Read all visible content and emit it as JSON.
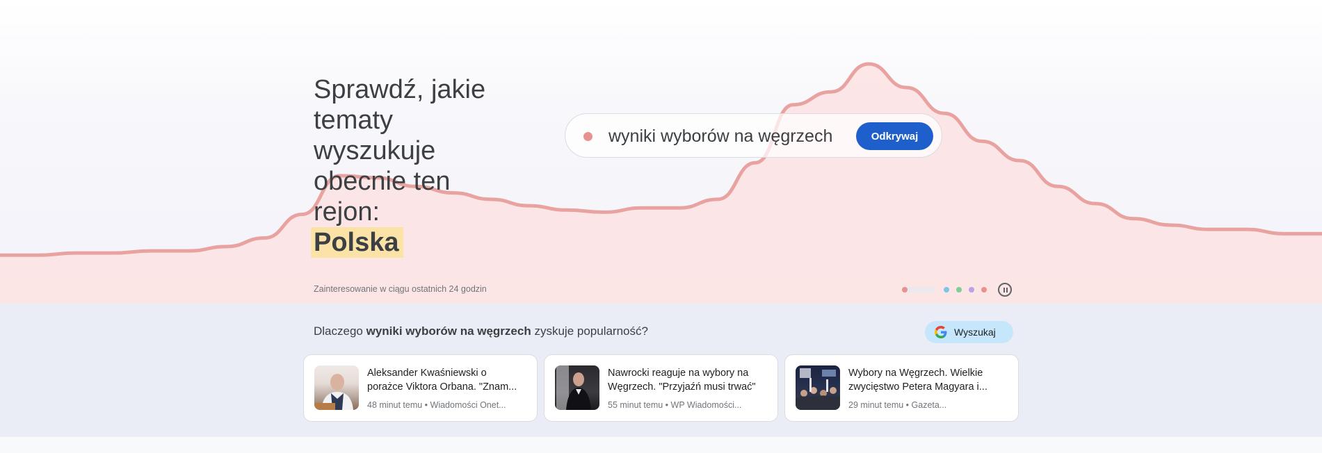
{
  "hero": {
    "headline": "Sprawdź, jakie tematy wyszukuje obecnie ten rejon:",
    "region": "Polska",
    "caption": "Zainteresowanie w ciągu ostatnich 24 godzin",
    "search_term": "wyniki wyborów na węgrzech",
    "discover_label": "Odkrywaj",
    "trend_color": "#e8a3a1",
    "trend_fill": "#fbe2e2",
    "carousel": {
      "active_index": 0,
      "dot_colors": [
        "#e8928f",
        "#7cc6ea",
        "#7ccf96",
        "#b9a2e6",
        "#e8928f"
      ]
    }
  },
  "chart_data": {
    "type": "area",
    "title": "",
    "xlabel": "Zainteresowanie w ciągu ostatnich 24 godzin",
    "ylabel": "",
    "grid": false,
    "values": [
      8,
      8,
      9,
      9,
      10,
      10,
      12,
      16,
      27,
      45,
      44,
      40,
      37,
      34,
      31,
      29,
      28,
      30,
      30,
      34,
      51,
      78,
      84,
      97,
      86,
      74,
      61,
      52,
      40,
      32,
      25,
      22,
      20,
      20,
      18,
      18
    ]
  },
  "why": {
    "prefix": "Dlaczego",
    "term": "wyniki wyborów na węgrzech",
    "suffix": "zyskuje popularność?",
    "search_label": "Wyszukaj"
  },
  "cards": [
    {
      "title": "Aleksander Kwaśniewski o porażce Viktora Orbana. \"Znam...",
      "meta": "48 minut temu • Wiadomości Onet..."
    },
    {
      "title": "Nawrocki reaguje na wybory na Węgrzech. \"Przyjaźń musi trwać\"",
      "meta": "55 minut temu • WP Wiadomości..."
    },
    {
      "title": "Wybory na Węgrzech. Wielkie zwycięstwo Petera Magyara i...",
      "meta": "29 minut temu • Gazeta..."
    }
  ]
}
